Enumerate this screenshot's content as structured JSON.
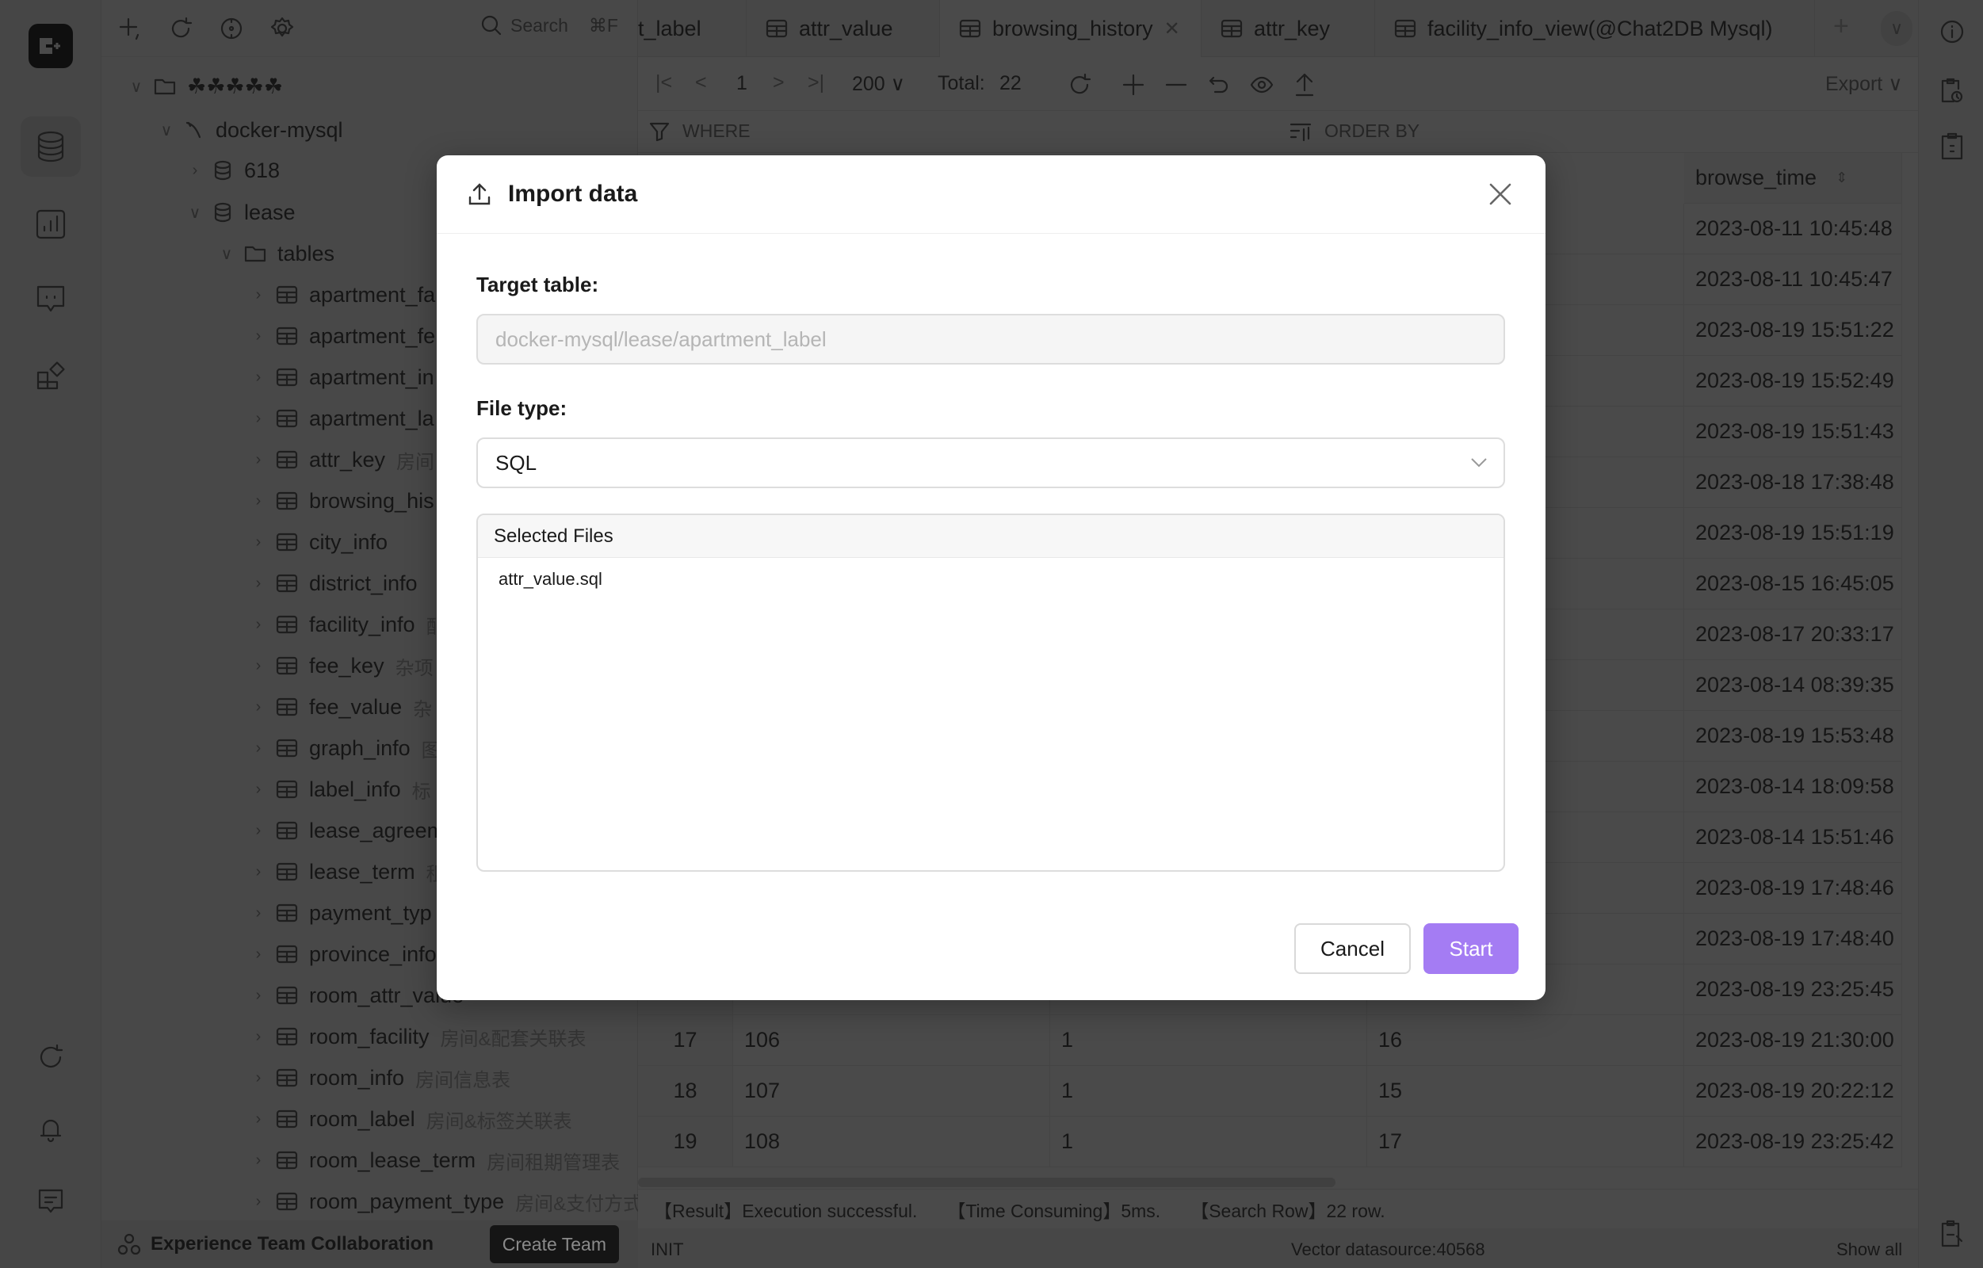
{
  "sidebar_toolbar": {
    "search_label": "Search",
    "search_shortcut": "⌘F"
  },
  "tree": {
    "root": "☘☘☘☘☘",
    "connection": "docker-mysql",
    "databases": [
      "618",
      "lease"
    ],
    "folder": "tables",
    "tables": [
      {
        "name": "apartment_fa",
        "comment": ""
      },
      {
        "name": "apartment_fe",
        "comment": ""
      },
      {
        "name": "apartment_in",
        "comment": ""
      },
      {
        "name": "apartment_la",
        "comment": ""
      },
      {
        "name": "attr_key",
        "comment": "房间"
      },
      {
        "name": "browsing_his",
        "comment": ""
      },
      {
        "name": "city_info",
        "comment": ""
      },
      {
        "name": "district_info",
        "comment": ""
      },
      {
        "name": "facility_info",
        "comment": "配"
      },
      {
        "name": "fee_key",
        "comment": "杂项"
      },
      {
        "name": "fee_value",
        "comment": "杂"
      },
      {
        "name": "graph_info",
        "comment": "图"
      },
      {
        "name": "label_info",
        "comment": "标"
      },
      {
        "name": "lease_agreem",
        "comment": ""
      },
      {
        "name": "lease_term",
        "comment": "租"
      },
      {
        "name": "payment_typ",
        "comment": ""
      },
      {
        "name": "province_info",
        "comment": ""
      },
      {
        "name": "room_attr_value",
        "comment": ""
      },
      {
        "name": "room_facility",
        "comment": "房间&配套关联表"
      },
      {
        "name": "room_info",
        "comment": "房间信息表"
      },
      {
        "name": "room_label",
        "comment": "房间&标签关联表"
      },
      {
        "name": "room_lease_term",
        "comment": "房间租期管理表"
      },
      {
        "name": "room_payment_type",
        "comment": "房间&支付方式"
      }
    ]
  },
  "team": {
    "label": "Experience Team Collaboration",
    "button": "Create Team"
  },
  "tabs": [
    {
      "label": "t_label",
      "icon": "table-icon",
      "active": false
    },
    {
      "label": "attr_value",
      "icon": "table-icon",
      "active": false
    },
    {
      "label": "browsing_history",
      "icon": "table-icon",
      "active": true,
      "closable": true
    },
    {
      "label": "attr_key",
      "icon": "table-icon",
      "active": false
    },
    {
      "label": "facility_info_view(@Chat2DB Mysql)",
      "icon": "view-icon",
      "active": false
    }
  ],
  "toolbar": {
    "page": "1",
    "page_size": "200",
    "total_label": "Total:",
    "total": "22",
    "export": "Export"
  },
  "filter": {
    "where": "WHERE",
    "order_by": "ORDER BY"
  },
  "table": {
    "visible_header": "browse_time",
    "rows": [
      {
        "n": "",
        "c1": "",
        "c2": "",
        "c3": "",
        "browse_time": "2023-08-11 10:45:48"
      },
      {
        "n": "",
        "c1": "",
        "c2": "",
        "c3": "",
        "browse_time": "2023-08-11 10:45:47"
      },
      {
        "n": "",
        "c1": "",
        "c2": "",
        "c3": "",
        "browse_time": "2023-08-19 15:51:22"
      },
      {
        "n": "",
        "c1": "",
        "c2": "",
        "c3": "",
        "browse_time": "2023-08-19 15:52:49"
      },
      {
        "n": "",
        "c1": "",
        "c2": "",
        "c3": "",
        "browse_time": "2023-08-19 15:51:43"
      },
      {
        "n": "",
        "c1": "",
        "c2": "",
        "c3": "",
        "browse_time": "2023-08-18 17:38:48"
      },
      {
        "n": "",
        "c1": "",
        "c2": "",
        "c3": "",
        "browse_time": "2023-08-19 15:51:19"
      },
      {
        "n": "",
        "c1": "",
        "c2": "",
        "c3": "",
        "browse_time": "2023-08-15 16:45:05"
      },
      {
        "n": "",
        "c1": "",
        "c2": "",
        "c3": "",
        "browse_time": "2023-08-17 20:33:17"
      },
      {
        "n": "",
        "c1": "",
        "c2": "",
        "c3": "",
        "browse_time": "2023-08-14 08:39:35"
      },
      {
        "n": "",
        "c1": "",
        "c2": "",
        "c3": "",
        "browse_time": "2023-08-19 15:53:48"
      },
      {
        "n": "",
        "c1": "",
        "c2": "",
        "c3": "",
        "browse_time": "2023-08-14 18:09:58"
      },
      {
        "n": "",
        "c1": "",
        "c2": "",
        "c3": "",
        "browse_time": "2023-08-14 15:51:46"
      },
      {
        "n": "",
        "c1": "",
        "c2": "",
        "c3": "",
        "browse_time": "2023-08-19 17:48:46"
      },
      {
        "n": "",
        "c1": "",
        "c2": "",
        "c3": "",
        "browse_time": "2023-08-19 17:48:40"
      },
      {
        "n": "",
        "c1": "",
        "c2": "",
        "c3": "",
        "browse_time": "2023-08-19 23:25:45"
      },
      {
        "n": "17",
        "c1": "106",
        "c2": "1",
        "c3": "16",
        "browse_time": "2023-08-19 21:30:00"
      },
      {
        "n": "18",
        "c1": "107",
        "c2": "1",
        "c3": "15",
        "browse_time": "2023-08-19 20:22:12"
      },
      {
        "n": "19",
        "c1": "108",
        "c2": "1",
        "c3": "17",
        "browse_time": "2023-08-19 23:25:42"
      }
    ]
  },
  "status": {
    "result": "【Result】Execution successful.",
    "time": "【Time Consuming】5ms.",
    "rows": "【Search Row】22 row."
  },
  "bottom": {
    "state": "INIT",
    "vector": "Vector datasource:40568",
    "show_all": "Show all"
  },
  "modal": {
    "title": "Import data",
    "target_label": "Target table:",
    "target_value": "docker-mysql/lease/apartment_label",
    "file_type_label": "File type:",
    "file_type_value": "SQL",
    "files_header": "Selected Files",
    "files": [
      "attr_value.sql"
    ],
    "cancel": "Cancel",
    "start": "Start"
  },
  "colors": {
    "primary": "#a47cf3",
    "overlay": "rgba(0,0,0,0.71)"
  }
}
